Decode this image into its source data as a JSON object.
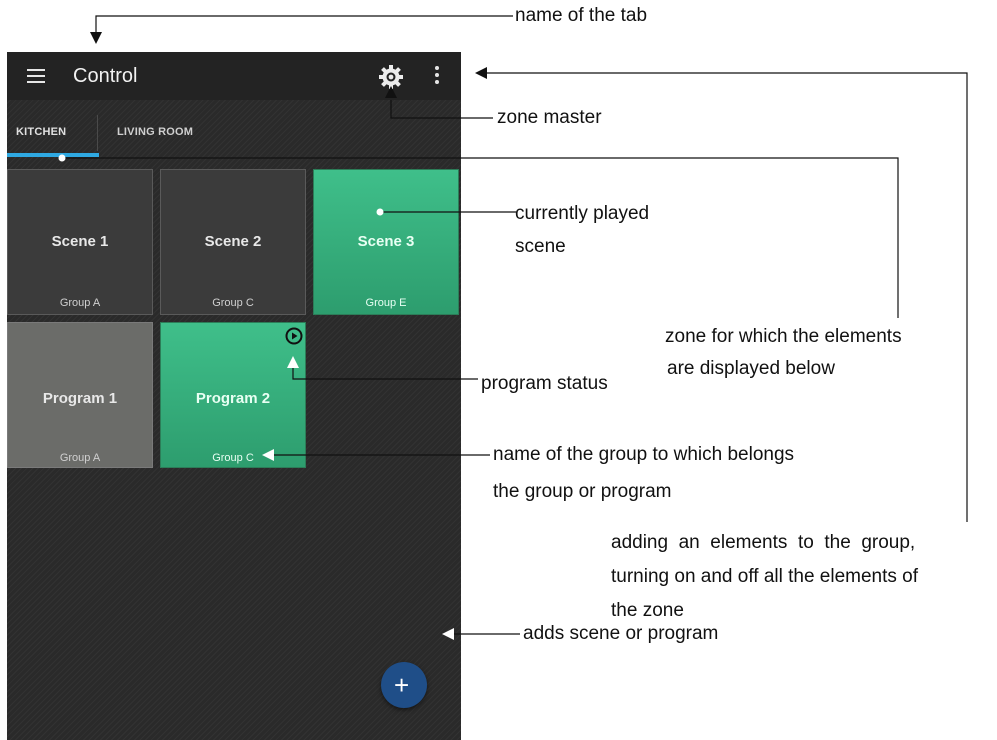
{
  "app": {
    "title": "Control"
  },
  "icons": {
    "menu": "hamburger-menu-icon",
    "zone_master": "gear-icon",
    "more": "more-vertical-icon",
    "status": "play-circle-icon",
    "fab": "plus-icon"
  },
  "tabs": [
    {
      "label": "KITCHEN",
      "selected": true
    },
    {
      "label": "LIVING ROOM",
      "selected": false
    }
  ],
  "scenes": [
    {
      "name": "Scene 1",
      "group": "Group A",
      "active": false
    },
    {
      "name": "Scene 2",
      "group": "Group C",
      "active": false
    },
    {
      "name": "Scene 3",
      "group": "Group E",
      "active": true
    }
  ],
  "programs": [
    {
      "name": "Program 1",
      "group": "Group A",
      "running": false
    },
    {
      "name": "Program 2",
      "group": "Group C",
      "running": true
    }
  ],
  "fab": {
    "label": "+"
  },
  "annotations": {
    "tab_name": "name of the tab",
    "zone_master": "zone master",
    "current_scene_1": "currently  played",
    "current_scene_2": "scene",
    "zone_1": "zone for which the elements",
    "zone_2": "are displayed below",
    "program_status": "program status",
    "group_name_1": "name of the group to which belongs",
    "group_name_2": "the group or program",
    "menu_1": "adding  an  elements  to  the  group,",
    "menu_2": "turning on and off all the elements of",
    "menu_3": "the zone",
    "fab": "adds scene or program"
  },
  "colors": {
    "accent_blue": "#2fa9e2",
    "active_green": "#3fbf8a",
    "fab": "#1f4e88",
    "background": "#2a2a2a"
  }
}
